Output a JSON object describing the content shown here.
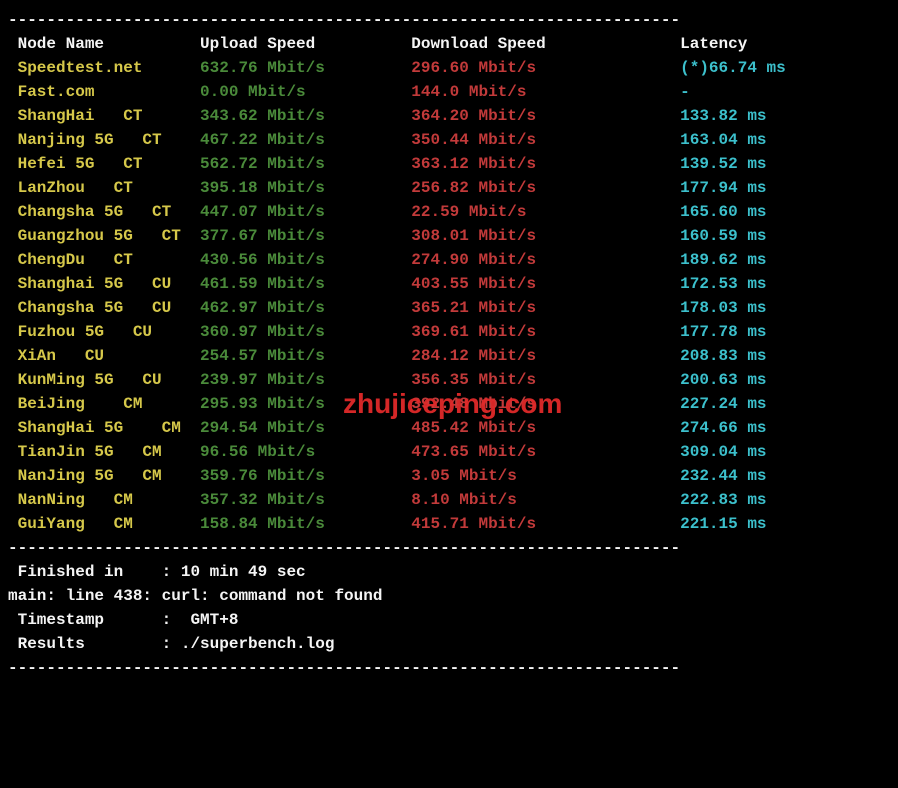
{
  "headers": {
    "node": "Node Name",
    "upload": "Upload Speed",
    "download": "Download Speed",
    "latency": "Latency"
  },
  "rows": [
    {
      "node_color": "yellow",
      "node": "Speedtest.net",
      "upload": "632.76 Mbit/s",
      "download": "296.60 Mbit/s",
      "latency": "(*)66.74 ms"
    },
    {
      "node_color": "yellow",
      "node": "Fast.com",
      "upload": "0.00 Mbit/s",
      "download": "144.0 Mbit/s",
      "latency": "-"
    },
    {
      "node_color": "yellow",
      "node": "ShangHai   CT",
      "upload": "343.62 Mbit/s",
      "download": "364.20 Mbit/s",
      "latency": "133.82 ms"
    },
    {
      "node_color": "yellow",
      "node": "Nanjing 5G   CT",
      "upload": "467.22 Mbit/s",
      "download": "350.44 Mbit/s",
      "latency": "163.04 ms"
    },
    {
      "node_color": "yellow",
      "node": "Hefei 5G   CT",
      "upload": "562.72 Mbit/s",
      "download": "363.12 Mbit/s",
      "latency": "139.52 ms"
    },
    {
      "node_color": "yellow",
      "node": "LanZhou   CT",
      "upload": "395.18 Mbit/s",
      "download": "256.82 Mbit/s",
      "latency": "177.94 ms"
    },
    {
      "node_color": "yellow",
      "node": "Changsha 5G   CT",
      "upload": "447.07 Mbit/s",
      "download": "22.59 Mbit/s",
      "latency": "165.60 ms"
    },
    {
      "node_color": "yellow",
      "node": "Guangzhou 5G   CT",
      "upload": "377.67 Mbit/s",
      "download": "308.01 Mbit/s",
      "latency": "160.59 ms"
    },
    {
      "node_color": "yellow",
      "node": "ChengDu   CT",
      "upload": "430.56 Mbit/s",
      "download": "274.90 Mbit/s",
      "latency": "189.62 ms"
    },
    {
      "node_color": "yellow",
      "node": "Shanghai 5G   CU",
      "upload": "461.59 Mbit/s",
      "download": "403.55 Mbit/s",
      "latency": "172.53 ms"
    },
    {
      "node_color": "yellow",
      "node": "Changsha 5G   CU",
      "upload": "462.97 Mbit/s",
      "download": "365.21 Mbit/s",
      "latency": "178.03 ms"
    },
    {
      "node_color": "yellow",
      "node": "Fuzhou 5G   CU",
      "upload": "360.97 Mbit/s",
      "download": "369.61 Mbit/s",
      "latency": "177.78 ms"
    },
    {
      "node_color": "yellow",
      "node": "XiAn   CU",
      "upload": "254.57 Mbit/s",
      "download": "284.12 Mbit/s",
      "latency": "208.83 ms"
    },
    {
      "node_color": "yellow",
      "node": "KunMing 5G   CU",
      "upload": "239.97 Mbit/s",
      "download": "356.35 Mbit/s",
      "latency": "200.63 ms"
    },
    {
      "node_color": "yellow",
      "node": "BeiJing    CM",
      "upload": "295.93 Mbit/s",
      "download": "392.48 Mbit/s",
      "latency": "227.24 ms"
    },
    {
      "node_color": "yellow",
      "node": "ShangHai 5G    CM",
      "upload": "294.54 Mbit/s",
      "download": "485.42 Mbit/s",
      "latency": "274.66 ms"
    },
    {
      "node_color": "yellow",
      "node": "TianJin 5G   CM",
      "upload": "96.56 Mbit/s",
      "download": "473.65 Mbit/s",
      "latency": "309.04 ms"
    },
    {
      "node_color": "yellow",
      "node": "NanJing 5G   CM",
      "upload": "359.76 Mbit/s",
      "download": "3.05 Mbit/s",
      "latency": "232.44 ms"
    },
    {
      "node_color": "yellow",
      "node": "NanNing   CM",
      "upload": "357.32 Mbit/s",
      "download": "8.10 Mbit/s",
      "latency": "222.83 ms"
    },
    {
      "node_color": "yellow",
      "node": "GuiYang   CM",
      "upload": "158.84 Mbit/s",
      "download": "415.71 Mbit/s",
      "latency": "221.15 ms"
    }
  ],
  "footer": {
    "finished_label": " Finished in    :",
    "finished_value": " 10 min 49 sec",
    "error_line": "main: line 438: curl: command not found",
    "timestamp_label": " Timestamp      :",
    "timestamp_value": "  GMT+8",
    "results_label": " Results        :",
    "results_value": " ./superbench.log"
  },
  "divider": "----------------------------------------------------------------------",
  "watermark": "zhujiceping.com",
  "col_widths": {
    "node": 19,
    "upload": 22,
    "download": 28
  }
}
